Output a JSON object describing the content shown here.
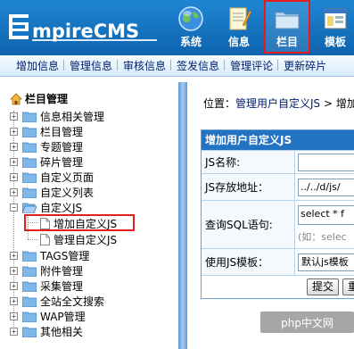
{
  "header": {
    "logo_text": "EmpireCMS",
    "nav": [
      {
        "label": "系统",
        "icon": "globe-icon",
        "active": false
      },
      {
        "label": "信息",
        "icon": "notepad-icon",
        "active": false
      },
      {
        "label": "栏目",
        "icon": "folder-icon",
        "active": true
      },
      {
        "label": "模板",
        "icon": "window-icon",
        "active": false
      }
    ]
  },
  "subnav": {
    "items": [
      "增加信息",
      "管理信息",
      "审核信息",
      "签发信息",
      "管理评论",
      "更新碎片"
    ]
  },
  "tree": {
    "title": "栏目管理",
    "nodes": [
      {
        "label": "信息相关管理",
        "expanded": false
      },
      {
        "label": "栏目管理",
        "expanded": false
      },
      {
        "label": "专题管理",
        "expanded": false
      },
      {
        "label": "碎片管理",
        "expanded": false
      },
      {
        "label": "自定义页面",
        "expanded": false
      },
      {
        "label": "自定义列表",
        "expanded": false
      },
      {
        "label": "自定义JS",
        "expanded": true,
        "children": [
          {
            "label": "增加自定义JS",
            "selected": true
          },
          {
            "label": "管理自定义JS",
            "selected": false
          }
        ]
      },
      {
        "label": "TAGS管理",
        "expanded": false
      },
      {
        "label": "附件管理",
        "expanded": false
      },
      {
        "label": "采集管理",
        "expanded": false
      },
      {
        "label": "全站全文搜索",
        "expanded": false
      },
      {
        "label": "WAP管理",
        "expanded": false
      },
      {
        "label": "其他相关",
        "expanded": false
      }
    ]
  },
  "content": {
    "breadcrumb_prefix": "位置：",
    "breadcrumb_link": "管理用户自定义JS",
    "breadcrumb_sep": " > ",
    "breadcrumb_current": "增加",
    "form_title": "增加用户自定义JS",
    "fields": {
      "js_name": {
        "label": "JS名称:",
        "value": ""
      },
      "js_path": {
        "label": "JS存放地址：",
        "value": "../../d/js/"
      },
      "sql": {
        "label": "查询SQL语句:",
        "value": "select * f",
        "hint": "(如：selec"
      },
      "template": {
        "label": "使用JS模板：",
        "value": "默认js模板"
      }
    },
    "buttons": {
      "submit": "提交",
      "reset": "重"
    }
  },
  "watermark": {
    "text": "php中文网",
    "brand": "php"
  },
  "colors": {
    "header_blue": "#1577c8",
    "highlight_red": "#e02020",
    "form_head": "#2273c2",
    "link": "#00206c"
  }
}
